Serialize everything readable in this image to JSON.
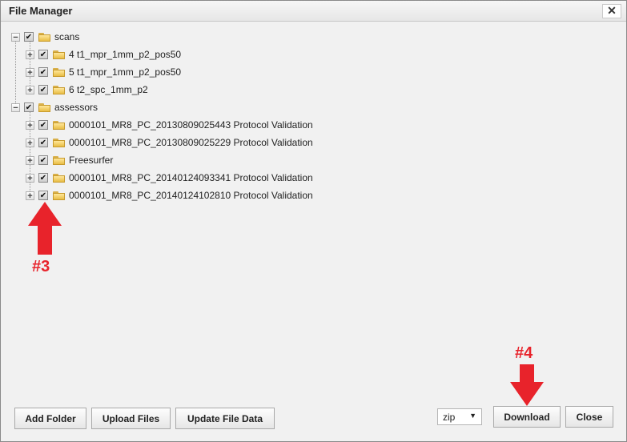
{
  "window": {
    "title": "File Manager",
    "close_glyph": "✕"
  },
  "tree": {
    "nodes": [
      {
        "label": "scans",
        "expander": "−",
        "checked": "✔"
      },
      {
        "label": "4 t1_mpr_1mm_p2_pos50",
        "expander": "+",
        "checked": "✔"
      },
      {
        "label": "5 t1_mpr_1mm_p2_pos50",
        "expander": "+",
        "checked": "✔"
      },
      {
        "label": "6 t2_spc_1mm_p2",
        "expander": "+",
        "checked": "✔"
      },
      {
        "label": "assessors",
        "expander": "−",
        "checked": "✔"
      },
      {
        "label": "0000101_MR8_PC_20130809025443 Protocol Validation",
        "expander": "+",
        "checked": "✔"
      },
      {
        "label": "0000101_MR8_PC_20130809025229 Protocol Validation",
        "expander": "+",
        "checked": "✔"
      },
      {
        "label": "Freesurfer",
        "expander": "+",
        "checked": "✔"
      },
      {
        "label": "0000101_MR8_PC_20140124093341 Protocol Validation",
        "expander": "+",
        "checked": "✔"
      },
      {
        "label": "0000101_MR8_PC_20140124102810 Protocol Validation",
        "expander": "+",
        "checked": "✔"
      }
    ]
  },
  "footer": {
    "add_folder": "Add Folder",
    "upload_files": "Upload Files",
    "update_file_data": "Update File Data",
    "format_value": "zip",
    "format_arrow": "▼",
    "download": "Download",
    "close": "Close"
  },
  "annotations": {
    "step3": "#3",
    "step4": "#4",
    "color": "#e8232b"
  }
}
